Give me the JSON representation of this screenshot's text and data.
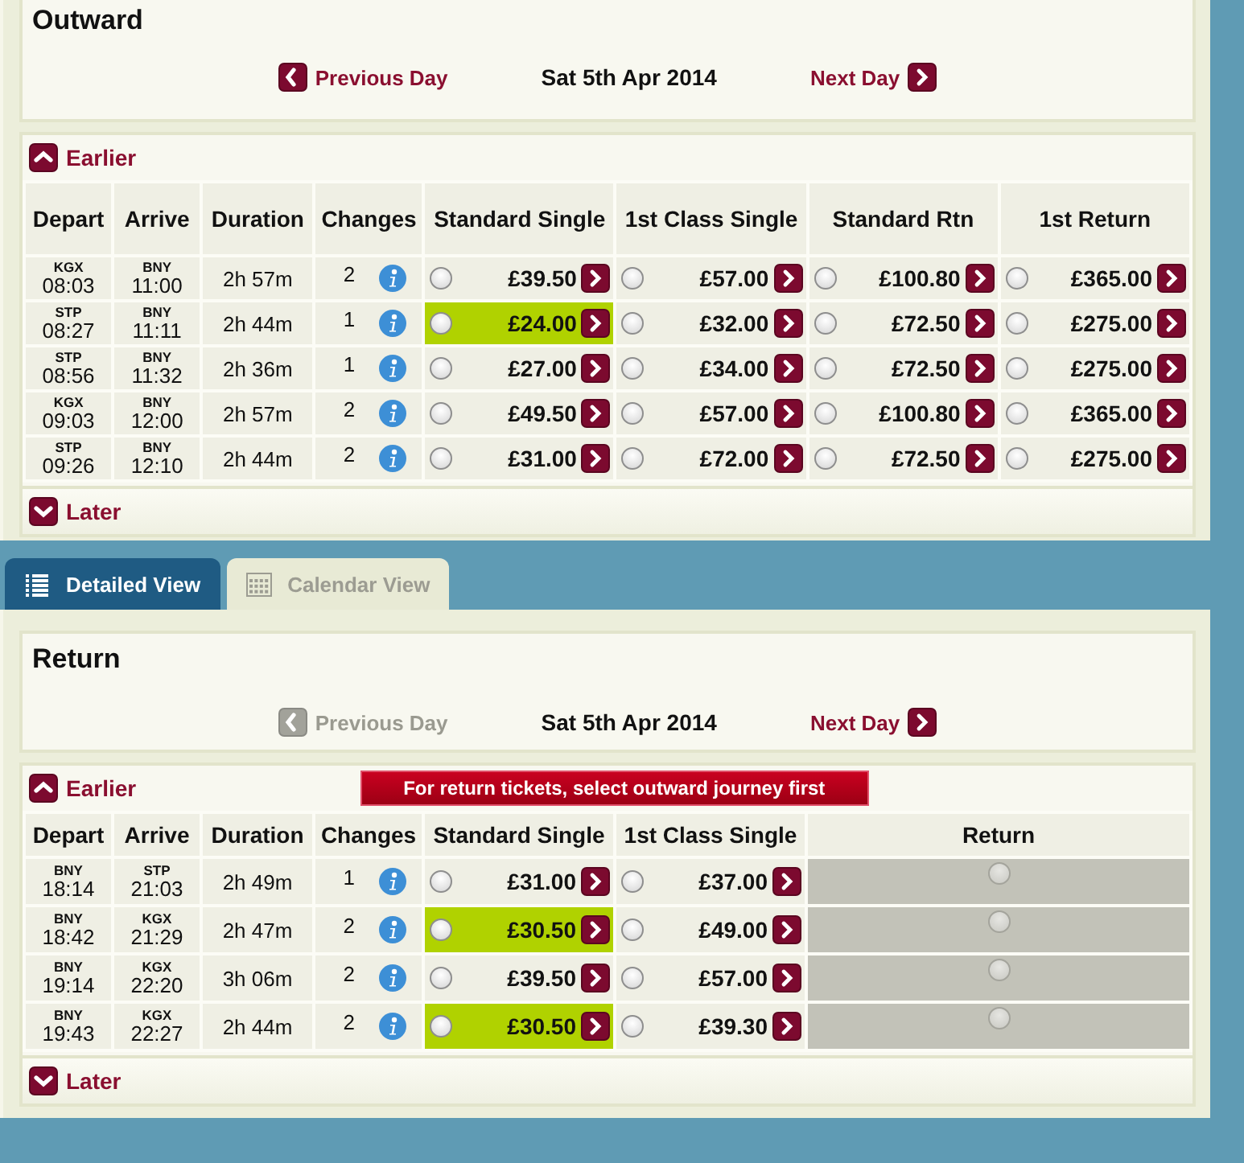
{
  "outward": {
    "title": "Outward",
    "previous_day": {
      "label": "Previous Day",
      "disabled": false
    },
    "date": "Sat 5th Apr 2014",
    "next_day": {
      "label": "Next Day",
      "disabled": false
    },
    "earlier": "Earlier",
    "columns": [
      {
        "label": "Depart",
        "kind": "depart"
      },
      {
        "label": "Arrive",
        "kind": "arrive"
      },
      {
        "label": "Duration",
        "kind": "duration"
      },
      {
        "label": "Changes",
        "kind": "changes"
      },
      {
        "label": "Standard Single",
        "kind": "fare"
      },
      {
        "label": "1st Class Single",
        "kind": "fare"
      },
      {
        "label": "Standard Rtn",
        "kind": "fare"
      },
      {
        "label": "1st Return",
        "kind": "fare"
      }
    ],
    "rows": [
      {
        "depart_station": "KGX",
        "depart_time": "08:03",
        "arrive_station": "BNY",
        "arrive_time": "11:00",
        "duration": "2h 57m",
        "changes": "2",
        "fares": [
          {
            "kind": "price",
            "price": "£39.50",
            "cheapest": false,
            "selected": false
          },
          {
            "kind": "price",
            "price": "£57.00",
            "cheapest": false,
            "selected": false
          },
          {
            "kind": "price",
            "price": "£100.80",
            "cheapest": false,
            "selected": false
          },
          {
            "kind": "price",
            "price": "£365.00",
            "cheapest": false,
            "selected": false
          }
        ]
      },
      {
        "depart_station": "STP",
        "depart_time": "08:27",
        "arrive_station": "BNY",
        "arrive_time": "11:11",
        "duration": "2h 44m",
        "changes": "1",
        "fares": [
          {
            "kind": "price",
            "price": "£24.00",
            "cheapest": true,
            "selected": false
          },
          {
            "kind": "price",
            "price": "£32.00",
            "cheapest": false,
            "selected": false
          },
          {
            "kind": "price",
            "price": "£72.50",
            "cheapest": false,
            "selected": false
          },
          {
            "kind": "price",
            "price": "£275.00",
            "cheapest": false,
            "selected": false
          }
        ]
      },
      {
        "depart_station": "STP",
        "depart_time": "08:56",
        "arrive_station": "BNY",
        "arrive_time": "11:32",
        "duration": "2h 36m",
        "changes": "1",
        "fares": [
          {
            "kind": "price",
            "price": "£27.00",
            "cheapest": false,
            "selected": false
          },
          {
            "kind": "price",
            "price": "£34.00",
            "cheapest": false,
            "selected": false
          },
          {
            "kind": "price",
            "price": "£72.50",
            "cheapest": false,
            "selected": false
          },
          {
            "kind": "price",
            "price": "£275.00",
            "cheapest": false,
            "selected": false
          }
        ]
      },
      {
        "depart_station": "KGX",
        "depart_time": "09:03",
        "arrive_station": "BNY",
        "arrive_time": "12:00",
        "duration": "2h 57m",
        "changes": "2",
        "fares": [
          {
            "kind": "price",
            "price": "£49.50",
            "cheapest": false,
            "selected": false
          },
          {
            "kind": "price",
            "price": "£57.00",
            "cheapest": false,
            "selected": false
          },
          {
            "kind": "price",
            "price": "£100.80",
            "cheapest": false,
            "selected": false
          },
          {
            "kind": "price",
            "price": "£365.00",
            "cheapest": false,
            "selected": false
          }
        ]
      },
      {
        "depart_station": "STP",
        "depart_time": "09:26",
        "arrive_station": "BNY",
        "arrive_time": "12:10",
        "duration": "2h 44m",
        "changes": "2",
        "fares": [
          {
            "kind": "price",
            "price": "£31.00",
            "cheapest": false,
            "selected": false
          },
          {
            "kind": "price",
            "price": "£72.00",
            "cheapest": false,
            "selected": false
          },
          {
            "kind": "price",
            "price": "£72.50",
            "cheapest": false,
            "selected": false
          },
          {
            "kind": "price",
            "price": "£275.00",
            "cheapest": false,
            "selected": false
          }
        ]
      }
    ],
    "later": "Later"
  },
  "view_tabs": [
    {
      "label": "Detailed View",
      "kind": "list",
      "selected": true
    },
    {
      "label": "Calendar View",
      "kind": "calendar",
      "selected": false
    }
  ],
  "return": {
    "title": "Return",
    "previous_day": {
      "label": "Previous Day",
      "disabled": true
    },
    "date": "Sat 5th Apr 2014",
    "next_day": {
      "label": "Next Day",
      "disabled": false
    },
    "earlier": "Earlier",
    "notice": "For return tickets, select outward journey first",
    "columns": [
      {
        "label": "Depart",
        "kind": "depart"
      },
      {
        "label": "Arrive",
        "kind": "arrive"
      },
      {
        "label": "Duration",
        "kind": "duration"
      },
      {
        "label": "Changes",
        "kind": "changes"
      },
      {
        "label": "Standard Single",
        "kind": "fare"
      },
      {
        "label": "1st Class Single",
        "kind": "fare"
      },
      {
        "label": "Return",
        "kind": "return"
      }
    ],
    "rows": [
      {
        "depart_station": "BNY",
        "depart_time": "18:14",
        "arrive_station": "STP",
        "arrive_time": "21:03",
        "duration": "2h 49m",
        "changes": "1",
        "fares": [
          {
            "kind": "price",
            "price": "£31.00",
            "cheapest": false,
            "selected": false
          },
          {
            "kind": "price",
            "price": "£37.00",
            "cheapest": false,
            "selected": false
          },
          {
            "kind": "option",
            "disabled": true,
            "selected": false
          }
        ]
      },
      {
        "depart_station": "BNY",
        "depart_time": "18:42",
        "arrive_station": "KGX",
        "arrive_time": "21:29",
        "duration": "2h 47m",
        "changes": "2",
        "fares": [
          {
            "kind": "price",
            "price": "£30.50",
            "cheapest": true,
            "selected": false
          },
          {
            "kind": "price",
            "price": "£49.00",
            "cheapest": false,
            "selected": false
          },
          {
            "kind": "option",
            "disabled": true,
            "selected": false
          }
        ]
      },
      {
        "depart_station": "BNY",
        "depart_time": "19:14",
        "arrive_station": "KGX",
        "arrive_time": "22:20",
        "duration": "3h 06m",
        "changes": "2",
        "fares": [
          {
            "kind": "price",
            "price": "£39.50",
            "cheapest": false,
            "selected": false
          },
          {
            "kind": "price",
            "price": "£57.00",
            "cheapest": false,
            "selected": false
          },
          {
            "kind": "option",
            "disabled": true,
            "selected": false
          }
        ]
      },
      {
        "depart_station": "BNY",
        "depart_time": "19:43",
        "arrive_station": "KGX",
        "arrive_time": "22:27",
        "duration": "2h 44m",
        "changes": "2",
        "fares": [
          {
            "kind": "price",
            "price": "£30.50",
            "cheapest": true,
            "selected": false
          },
          {
            "kind": "price",
            "price": "£39.30",
            "cheapest": false,
            "selected": false
          },
          {
            "kind": "option",
            "disabled": true,
            "selected": false
          }
        ]
      }
    ],
    "later": "Later"
  }
}
